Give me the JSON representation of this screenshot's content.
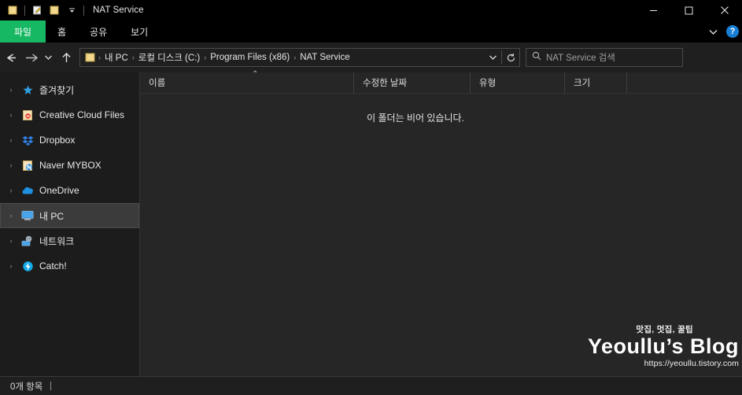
{
  "window": {
    "title": "NAT Service",
    "quick_access": [
      {
        "name": "folder-icon",
        "label": "폴더"
      },
      {
        "name": "properties-icon",
        "label": "속성"
      },
      {
        "name": "new-folder-icon",
        "label": "새 폴더"
      }
    ],
    "controls": {
      "minimize": "최소화",
      "maximize": "최대화",
      "close": "닫기"
    }
  },
  "ribbon": {
    "tabs": [
      {
        "label": "파일",
        "active": true
      },
      {
        "label": "홈",
        "active": false
      },
      {
        "label": "공유",
        "active": false
      },
      {
        "label": "보기",
        "active": false
      }
    ],
    "collapse_label": "리본 축소",
    "help_label": "?",
    "file_tab_color": "#16b863"
  },
  "nav": {
    "back": "뒤로",
    "forward": "앞으로",
    "recent": "최근 위치",
    "up": "위로",
    "breadcrumbs": [
      {
        "label": "내 PC"
      },
      {
        "label": "로컬 디스크 (C:)"
      },
      {
        "label": "Program Files (x86)"
      },
      {
        "label": "NAT Service"
      }
    ],
    "separator": "›",
    "history_dropdown": "이전 위치",
    "refresh": "새로 고침"
  },
  "search": {
    "placeholder": "NAT Service 검색",
    "icon": "search-icon"
  },
  "sidebar": {
    "items": [
      {
        "label": "즐겨찾기",
        "icon": "star-icon",
        "selected": false
      },
      {
        "label": "Creative Cloud Files",
        "icon": "creative-cloud-icon",
        "selected": false
      },
      {
        "label": "Dropbox",
        "icon": "dropbox-icon",
        "selected": false
      },
      {
        "label": "Naver MYBOX",
        "icon": "naver-mybox-icon",
        "selected": false
      },
      {
        "label": "OneDrive",
        "icon": "onedrive-icon",
        "selected": false
      },
      {
        "label": "내 PC",
        "icon": "this-pc-icon",
        "selected": true
      },
      {
        "label": "네트워크",
        "icon": "network-icon",
        "selected": false
      },
      {
        "label": "Catch!",
        "icon": "catch-icon",
        "selected": false
      }
    ],
    "expand_chevron": "›"
  },
  "file_list": {
    "columns": [
      {
        "label": "이름",
        "sorted": "asc"
      },
      {
        "label": "수정한 날짜",
        "sorted": ""
      },
      {
        "label": "유형",
        "sorted": ""
      },
      {
        "label": "크기",
        "sorted": ""
      }
    ],
    "sort_caret": "⌃",
    "rows": [],
    "empty_message": "이 폴더는 비어 있습니다."
  },
  "statusbar": {
    "item_count": "0개 항목"
  },
  "watermark": {
    "subtitle": "맛집, 멋집, 꿀팁",
    "title": "Yeoullu’s Blog",
    "url": "https://yeoullu.tistory.com"
  }
}
